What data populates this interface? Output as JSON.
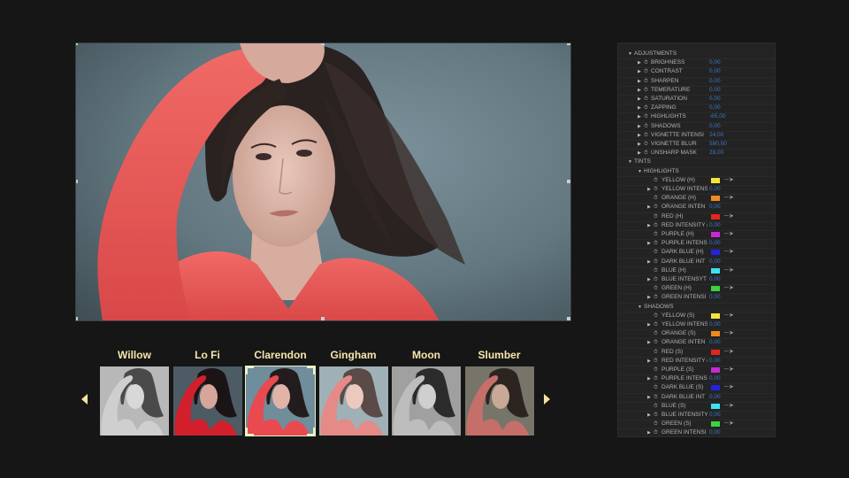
{
  "filters": {
    "items": [
      {
        "name": "Willow",
        "selected": false
      },
      {
        "name": "Lo Fi",
        "selected": false
      },
      {
        "name": "Clarendon",
        "selected": true
      },
      {
        "name": "Gingham",
        "selected": false
      },
      {
        "name": "Moon",
        "selected": false
      },
      {
        "name": "Slumber",
        "selected": false
      }
    ]
  },
  "panel": {
    "adjustments": {
      "title": "ADJUSTMENTS",
      "items": [
        {
          "label": "BRIGHNESS",
          "value": "0,00"
        },
        {
          "label": "CONTRAST",
          "value": "0,00"
        },
        {
          "label": "SHARPEN",
          "value": "0,00"
        },
        {
          "label": "TEMERATURE",
          "value": "0,00"
        },
        {
          "label": "SATURATION",
          "value": "0,00"
        },
        {
          "label": "ZAPPING",
          "value": "0,00"
        },
        {
          "label": "HIGHLIGHTS",
          "value": "-65,00"
        },
        {
          "label": "SHADOWS",
          "value": "0,00"
        },
        {
          "label": "VIGNETTE INTENSI",
          "value": "24,00"
        },
        {
          "label": "VIGNETTE BLUR",
          "value": "590,00"
        },
        {
          "label": "UNSHARP MASK",
          "value": "28,00"
        }
      ]
    },
    "tints": {
      "title": "TINTS",
      "groups": [
        {
          "title": "HIGHLIGHTS",
          "items": [
            {
              "label": "YELLOW (H)",
              "kind": "color",
              "color": "#f2e63a"
            },
            {
              "label": "YELLOW INTENS",
              "kind": "value",
              "value": "0,00"
            },
            {
              "label": "ORANGE (H)",
              "kind": "color",
              "color": "#f08a1e"
            },
            {
              "label": "ORANGE INTEN",
              "kind": "value",
              "value": "0,00"
            },
            {
              "label": "RED (H)",
              "kind": "color",
              "color": "#e3261d"
            },
            {
              "label": "RED INTENSITY (",
              "kind": "value",
              "value": "0,00"
            },
            {
              "label": "PURPLE (H)",
              "kind": "color",
              "color": "#c82ad2"
            },
            {
              "label": "PURPLE INTENSI",
              "kind": "value",
              "value": "0,00"
            },
            {
              "label": "DARK BLUE (H)",
              "kind": "color",
              "color": "#2323e0"
            },
            {
              "label": "DARK BLUE INT",
              "kind": "value",
              "value": "0,00"
            },
            {
              "label": "BLUE (H)",
              "kind": "color",
              "color": "#3ee1f0"
            },
            {
              "label": "BLUE INTENSYT",
              "kind": "value",
              "value": "0,00"
            },
            {
              "label": "GREEN (H)",
              "kind": "color",
              "color": "#3fd140"
            },
            {
              "label": "GREEN INTENSI",
              "kind": "value",
              "value": "0,00"
            }
          ]
        },
        {
          "title": "SHADOWS",
          "items": [
            {
              "label": "YELLOW (S)",
              "kind": "color",
              "color": "#f2e63a"
            },
            {
              "label": "YELLOW INTENS",
              "kind": "value",
              "value": "0,00"
            },
            {
              "label": "ORANGE (S)",
              "kind": "color",
              "color": "#f08a1e"
            },
            {
              "label": "ORANGE INTEN",
              "kind": "value",
              "value": "0,00"
            },
            {
              "label": "RED (S)",
              "kind": "color",
              "color": "#e3261d"
            },
            {
              "label": "RED INTENSITY (",
              "kind": "value",
              "value": "0,00"
            },
            {
              "label": "PURPLE (S)",
              "kind": "color",
              "color": "#c82ad2"
            },
            {
              "label": "PURPLE INTENSI",
              "kind": "value",
              "value": "0,00"
            },
            {
              "label": "DARK BLUE (S)",
              "kind": "color",
              "color": "#2323e0"
            },
            {
              "label": "DARK BLUE INT",
              "kind": "value",
              "value": "0,00"
            },
            {
              "label": "BLUE (S)",
              "kind": "color",
              "color": "#3ee1f0"
            },
            {
              "label": "BLUE INTENSITY",
              "kind": "value",
              "value": "0,00"
            },
            {
              "label": "GREEN (S)",
              "kind": "color",
              "color": "#3fd140"
            },
            {
              "label": "GREEN INTENSI",
              "kind": "value",
              "value": "0,00"
            }
          ]
        }
      ]
    }
  }
}
